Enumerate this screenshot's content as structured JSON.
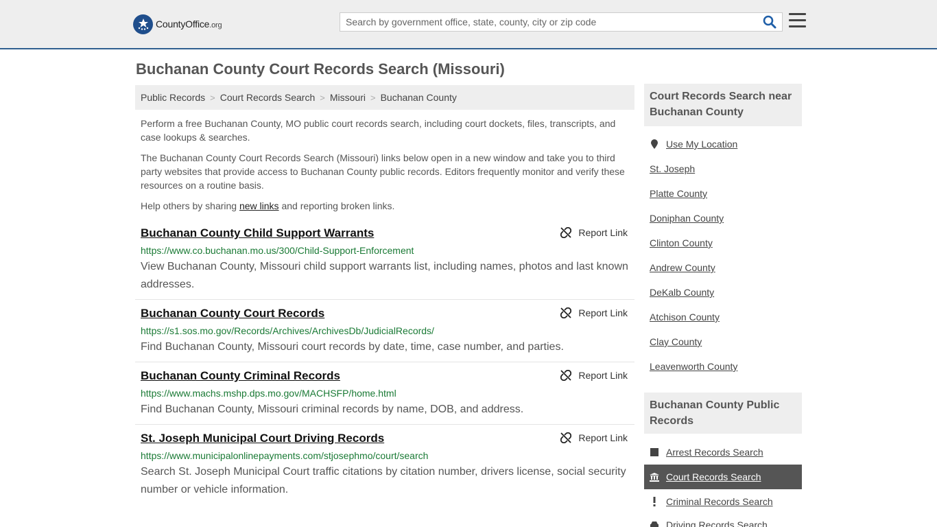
{
  "header": {
    "logo_name": "CountyOffice",
    "logo_tld": ".org",
    "search_placeholder": "Search by government office, state, county, city or zip code"
  },
  "page_title": "Buchanan County Court Records Search (Missouri)",
  "breadcrumb": [
    "Public Records",
    "Court Records Search",
    "Missouri",
    "Buchanan County"
  ],
  "intro": {
    "p1": "Perform a free Buchanan County, MO public court records search, including court dockets, files, transcripts, and case lookups & searches.",
    "p2": "The Buchanan County Court Records Search (Missouri) links below open in a new window and take you to third party websites that provide access to Buchanan County public records. Editors frequently monitor and verify these resources on a routine basis.",
    "p3_before": "Help others by sharing ",
    "p3_link": "new links",
    "p3_after": " and reporting broken links."
  },
  "report_label": "Report Link",
  "results": [
    {
      "title": "Buchanan County Child Support Warrants",
      "url": "https://www.co.buchanan.mo.us/300/Child-Support-Enforcement",
      "desc": "View Buchanan County, Missouri child support warrants list, including names, photos and last known addresses."
    },
    {
      "title": "Buchanan County Court Records",
      "url": "https://s1.sos.mo.gov/Records/Archives/ArchivesDb/JudicialRecords/",
      "desc": "Find Buchanan County, Missouri court records by date, time, case number, and parties."
    },
    {
      "title": "Buchanan County Criminal Records",
      "url": "https://www.machs.mshp.dps.mo.gov/MACHSFP/home.html",
      "desc": "Find Buchanan County, Missouri criminal records by name, DOB, and address."
    },
    {
      "title": "St. Joseph Municipal Court Driving Records",
      "url": "https://www.municipalonlinepayments.com/stjosephmo/court/search",
      "desc": "Search St. Joseph Municipal Court traffic citations by citation number, drivers license, social security number or vehicle information."
    }
  ],
  "sidebar": {
    "nearby_title": "Court Records Search near Buchanan County",
    "use_location": "Use My Location",
    "nearby": [
      "St. Joseph",
      "Platte County",
      "Doniphan County",
      "Clinton County",
      "Andrew County",
      "DeKalb County",
      "Atchison County",
      "Clay County",
      "Leavenworth County"
    ],
    "public_title": "Buchanan County Public Records",
    "public_links": [
      "Arrest Records Search",
      "Court Records Search",
      "Criminal Records Search",
      "Driving Records Search"
    ],
    "active_link": "Court Records Search"
  },
  "colors": {
    "header_bg": "#eeeeee",
    "header_border": "#2f5f8f",
    "url_green": "#1a7a35",
    "active_bg": "#555555",
    "logo_blue": "#1f4e8c"
  }
}
